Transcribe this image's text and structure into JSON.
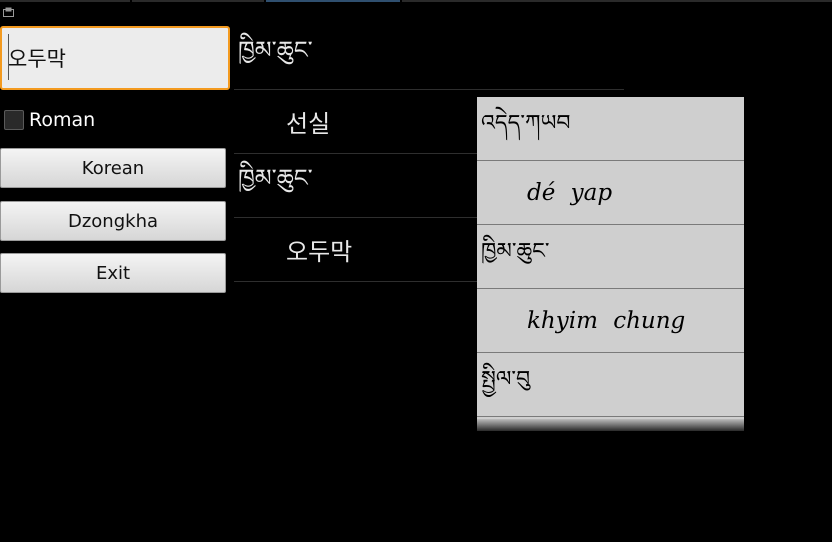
{
  "search": {
    "value": "오두막"
  },
  "roman": {
    "label": "Roman",
    "checked": false
  },
  "buttons": {
    "korean": "Korean",
    "dzongkha": "Dzongkha",
    "exit": "Exit"
  },
  "results": [
    {
      "kind": "dz",
      "text": "ཁྱིམ་ཆུང་"
    },
    {
      "kind": "ko",
      "text": "선실"
    },
    {
      "kind": "dz",
      "text": "ཁྱིམ་ཆུང་"
    },
    {
      "kind": "ko",
      "text": "오두막"
    }
  ],
  "suggestions": [
    {
      "kind": "dz",
      "text": "འདེད་ཀཡབ"
    },
    {
      "kind": "rom",
      "text": "dé yap"
    },
    {
      "kind": "dz",
      "text": "ཁྱིམ་ཆུང་"
    },
    {
      "kind": "rom",
      "text": "khyim chung"
    },
    {
      "kind": "dz",
      "text": "སྤྱིལ་བུ"
    }
  ],
  "colors": {
    "focus_border": "#f39a1f",
    "dropdown_bg": "#cfcfcf"
  }
}
